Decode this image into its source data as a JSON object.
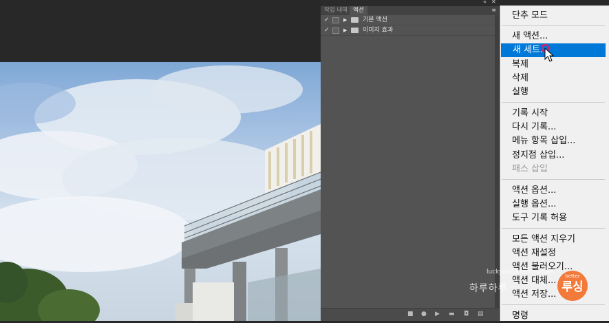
{
  "panel": {
    "tabs": [
      {
        "label": "작업 내역",
        "active": false
      },
      {
        "label": "액션",
        "active": true
      }
    ],
    "controls": {
      "collapse": "«",
      "close": "✕",
      "menu": "≡"
    },
    "actions": [
      {
        "checked": "✓",
        "label": "기본 액션"
      },
      {
        "checked": "✓",
        "label": "이미지 효과"
      }
    ],
    "footer_icons": [
      "stop-icon",
      "record-icon",
      "play-icon",
      "new-set-icon",
      "new-action-icon",
      "delete-icon"
    ]
  },
  "menu": {
    "items": [
      {
        "label": "단추 모드",
        "state": "normal"
      },
      {
        "label": "새 액션...",
        "state": "normal"
      },
      {
        "label": "새 세트...",
        "state": "highlight"
      },
      {
        "label": "복제",
        "state": "normal"
      },
      {
        "label": "삭제",
        "state": "normal"
      },
      {
        "label": "실행",
        "state": "normal"
      },
      {
        "label": "기록 시작",
        "state": "normal"
      },
      {
        "label": "다시 기록...",
        "state": "normal"
      },
      {
        "label": "메뉴 항목 삽입...",
        "state": "normal"
      },
      {
        "label": "정지점 삽입...",
        "state": "normal"
      },
      {
        "label": "패스 삽입",
        "state": "disabled"
      },
      {
        "label": "액션 옵션...",
        "state": "normal"
      },
      {
        "label": "실행 옵션...",
        "state": "normal"
      },
      {
        "label": "도구 기록 허용",
        "state": "normal"
      },
      {
        "label": "모든 액션 지우기",
        "state": "normal"
      },
      {
        "label": "액션 재설정",
        "state": "normal"
      },
      {
        "label": "액션 불러오기...",
        "state": "normal"
      },
      {
        "label": "액션 대체...",
        "state": "normal"
      },
      {
        "label": "액션 저장...",
        "state": "normal"
      },
      {
        "label": "명령",
        "state": "normal"
      }
    ]
  },
  "watermark": {
    "url": "luckyanna.tistory.com",
    "script": "하루하루",
    "badge_small": "better",
    "badge_big": "루싱"
  },
  "colors": {
    "highlight": "#0078d7",
    "panel": "#535353",
    "menu_bg": "#f0f0f0",
    "badge": "#f27a3a"
  }
}
